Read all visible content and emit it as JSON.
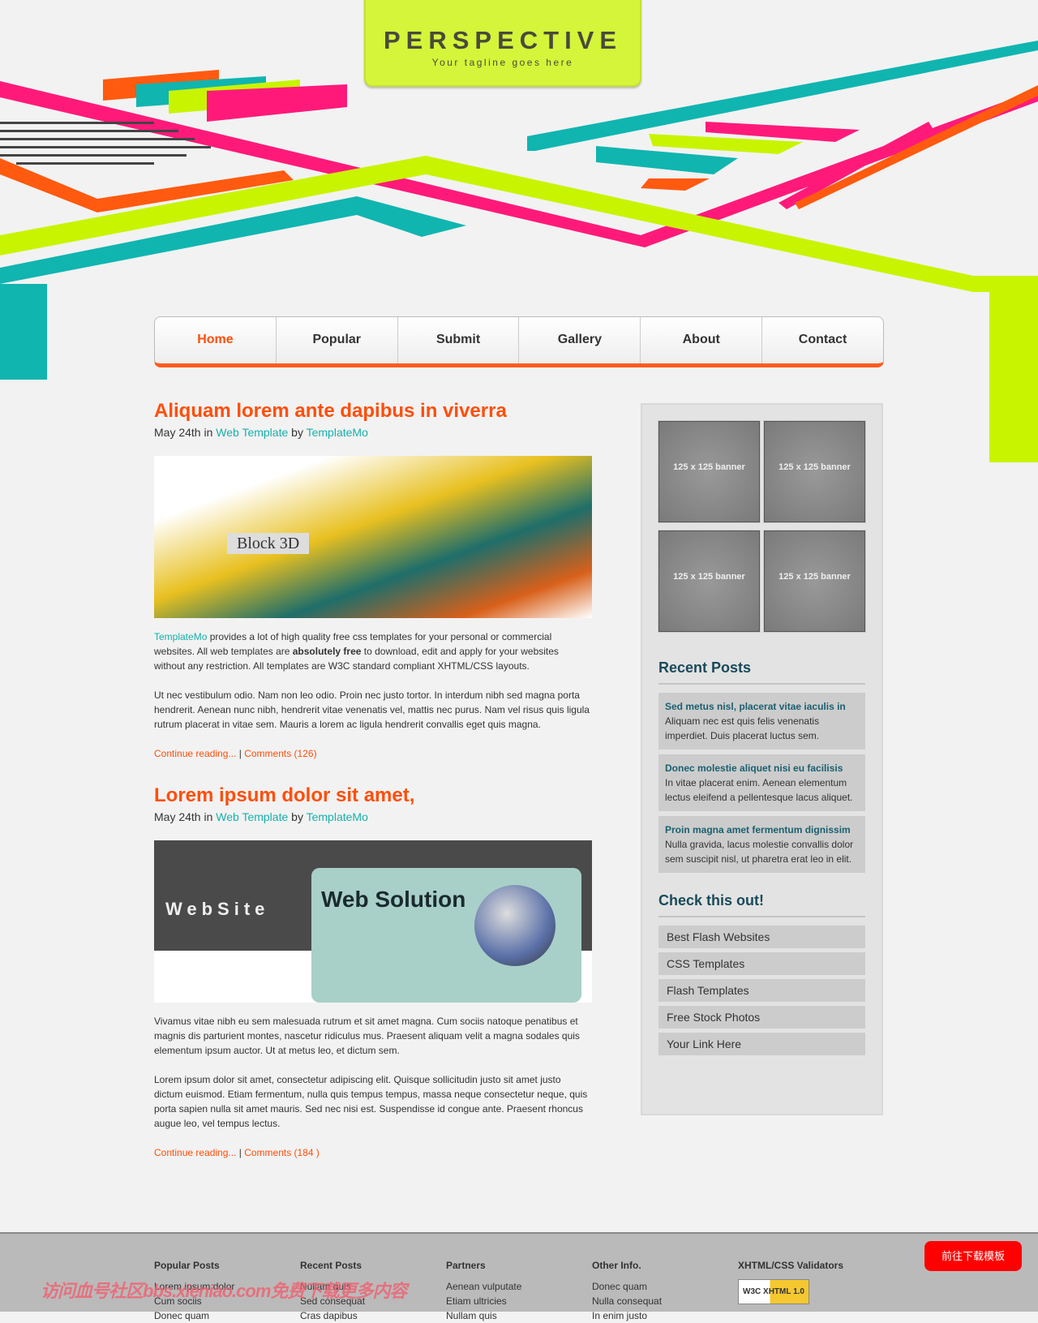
{
  "header": {
    "title": "PERSPECTIVE",
    "tagline": "Your tagline goes here"
  },
  "nav": [
    {
      "label": "Home",
      "active": true
    },
    {
      "label": "Popular"
    },
    {
      "label": "Submit"
    },
    {
      "label": "Gallery"
    },
    {
      "label": "About"
    },
    {
      "label": "Contact"
    }
  ],
  "posts": [
    {
      "title": "Aliquam lorem ante dapibus in viverra",
      "date": "May 24th",
      "in": "in",
      "category": "Web Template",
      "by": "by",
      "author": "TemplateMo",
      "image_text": "Block 3D",
      "p1_link": "TemplateMo",
      "p1a": " provides a lot of high quality free css templates for your personal or commercial websites. All web templates are ",
      "p1b": "absolutely free",
      "p1c": " to download, edit and apply for your websites without any restriction. All templates are W3C standard compliant XHTML/CSS layouts.",
      "p2": "Ut nec vestibulum odio. Nam non leo odio. Proin nec justo tortor. In interdum nibh sed magna porta hendrerit. Aenean nunc nibh, hendrerit vitae venenatis vel, mattis nec purus. Nam vel risus quis ligula rutrum placerat in vitae sem. Mauris a lorem ac ligula hendrerit convallis eget quis magna.",
      "more": "Continue reading...",
      "sep": " | ",
      "comments": "Comments (126)"
    },
    {
      "title": "Lorem ipsum dolor sit amet,",
      "date": "May 24th",
      "in": "in",
      "category": "Web Template",
      "by": "by",
      "author": "TemplateMo",
      "image_text": "Web Solution",
      "image_logo": "WebSite",
      "p1": "Vivamus vitae nibh eu sem malesuada rutrum et sit amet magna. Cum sociis natoque penatibus et magnis dis parturient montes, nascetur ridiculus mus. Praesent aliquam velit a magna sodales quis elementum ipsum auctor. Ut at metus leo, et dictum sem.",
      "p2": "Lorem ipsum dolor sit amet, consectetur adipiscing elit. Quisque sollicitudin justo sit amet justo dictum euismod. Etiam fermentum, nulla quis tempus tempus, massa neque consectetur neque, quis porta sapien nulla sit amet mauris. Sed nec nisi est. Suspendisse id congue ante. Praesent rhoncus augue leo, vel tempus lectus.",
      "more": "Continue reading...",
      "sep": " | ",
      "comments": "Comments (184 )"
    }
  ],
  "sidebar": {
    "banners": [
      "125 x 125 banner",
      "125 x 125 banner",
      "125 x 125 banner",
      "125 x 125 banner"
    ],
    "recent_title": "Recent Posts",
    "recent": [
      {
        "title": "Sed metus nisl, placerat vitae iaculis in",
        "text": "Aliquam nec est quis felis venenatis imperdiet. Duis placerat luctus sem."
      },
      {
        "title": "Donec molestie aliquet nisi eu facilisis",
        "text": "In vitae placerat enim. Aenean elementum lectus eleifend a pellentesque lacus aliquet."
      },
      {
        "title": "Proin magna amet fermentum dignissim",
        "text": "Nulla gravida, lacus molestie convallis dolor sem suscipit nisl, ut pharetra erat leo in elit."
      }
    ],
    "check_title": "Check this out!",
    "links": [
      "Best Flash Websites",
      "CSS Templates",
      "Flash Templates",
      "Free Stock Photos",
      "Your Link Here"
    ]
  },
  "footer": {
    "cols": [
      {
        "title": "Popular Posts",
        "items": [
          "Lorem ipsum dolor",
          "Cum sociis",
          "Donec quam"
        ]
      },
      {
        "title": "Recent Posts",
        "items": [
          "Nullam quis",
          "Sed consequat",
          "Cras dapibus"
        ]
      },
      {
        "title": "Partners",
        "items": [
          "Aenean vulputate",
          "Etiam ultricies",
          "Nullam quis"
        ]
      },
      {
        "title": "Other Info.",
        "items": [
          "Donec quam",
          "Nulla consequat",
          "In enim justo"
        ]
      }
    ],
    "validators_title": "XHTML/CSS Validators",
    "badge": "W3C XHTML 1.0"
  },
  "download_button": "前往下载模板",
  "watermark": "访问血号社区bbs.xieniao.com免费下载更多内容",
  "colors": {
    "accent": "#ff4e0a",
    "link": "#18b0aa",
    "lime": "#d4f53a"
  }
}
